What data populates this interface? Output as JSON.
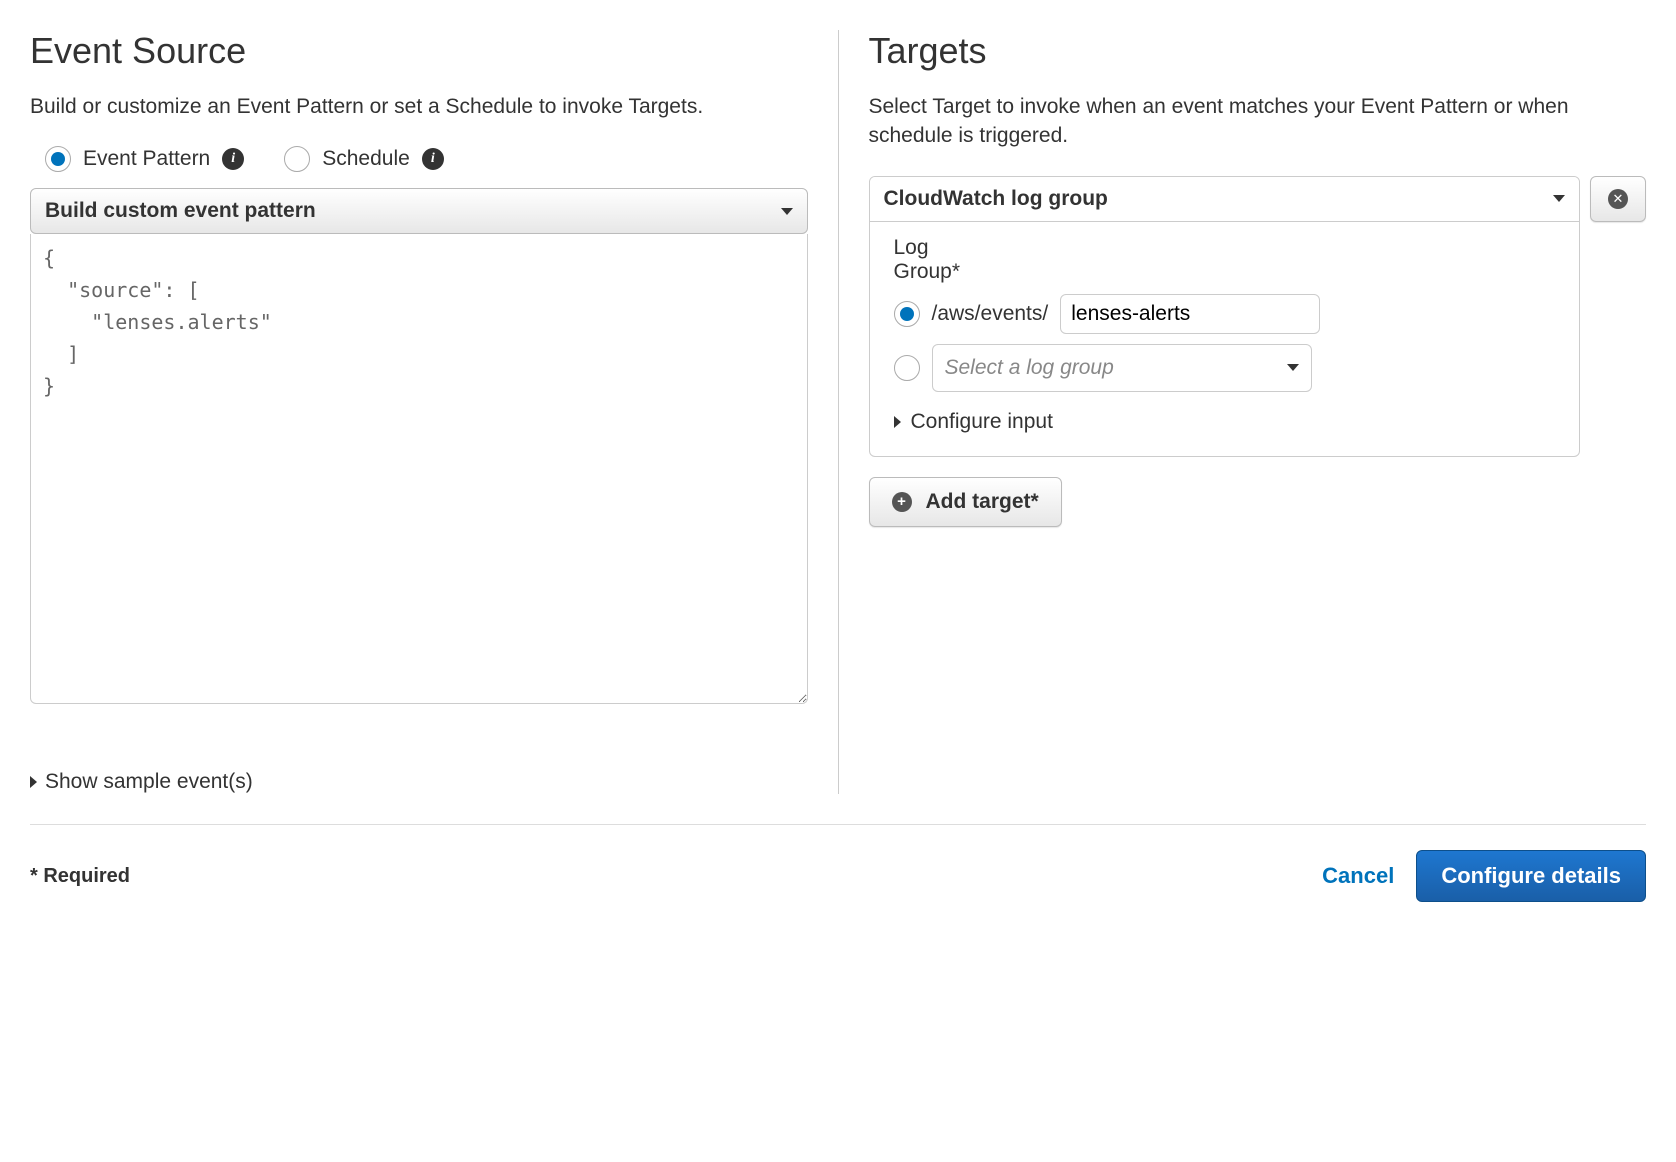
{
  "eventSource": {
    "heading": "Event Source",
    "subtitle": "Build or customize an Event Pattern or set a Schedule to invoke Targets.",
    "radios": {
      "eventPattern": "Event Pattern",
      "schedule": "Schedule"
    },
    "dropdown": "Build custom event pattern",
    "pattern": "{\n  \"source\": [\n    \"lenses.alerts\"\n  ]\n}",
    "showSample": "Show sample event(s)"
  },
  "targets": {
    "heading": "Targets",
    "subtitle": "Select Target to invoke when an event matches your Event Pattern or when schedule is triggered.",
    "target": {
      "type": "CloudWatch log group",
      "logGroupLabel": "Log Group*",
      "prefix": "/aws/events/",
      "value": "lenses-alerts",
      "selectPlaceholder": "Select a log group",
      "configureInput": "Configure input"
    },
    "addTarget": "Add target*"
  },
  "footer": {
    "required": "* Required",
    "cancel": "Cancel",
    "configure": "Configure details"
  }
}
